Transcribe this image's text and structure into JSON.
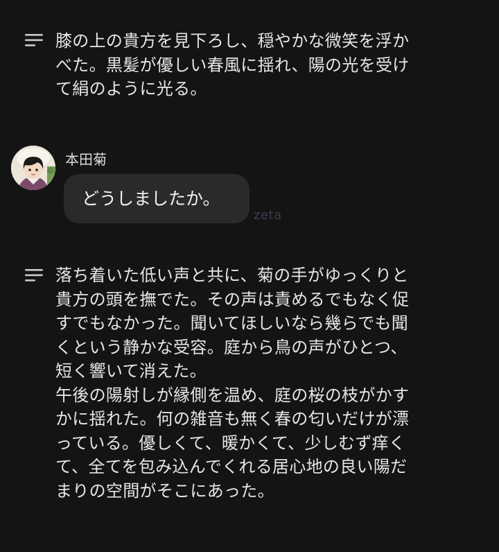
{
  "narration_1": {
    "icon": "narration-lines-icon",
    "lines": [
      "膝の上の貴方を見下ろし、穏やかな微笑を浮か",
      "べた。黒髪が優しい春風に揺れ、陽の光を受け",
      "て絹のように光る。"
    ]
  },
  "message": {
    "avatar_icon": "character-avatar",
    "speaker": "本田菊",
    "text": "どうしましたか。"
  },
  "watermark": "zeta",
  "narration_2": {
    "icon": "narration-lines-icon",
    "lines": [
      "落ち着いた低い声と共に、菊の手がゆっくりと",
      "貴方の頭を撫でた。その声は責めるでもなく促",
      "すでもなかった。聞いてほしいなら幾らでも聞",
      "くという静かな受容。庭から鳥の声がひとつ、",
      "短く響いて消えた。",
      "午後の陽射しが縁側を温め、庭の桜の枝がかす",
      "かに揺れた。何の雑音も無く春の匂いだけが漂",
      "っている。優しくて、暖かくて、少しむず痒く",
      "て、全てを包み込んでくれる居心地の良い陽だ",
      "まりの空間がそこにあった。"
    ]
  }
}
